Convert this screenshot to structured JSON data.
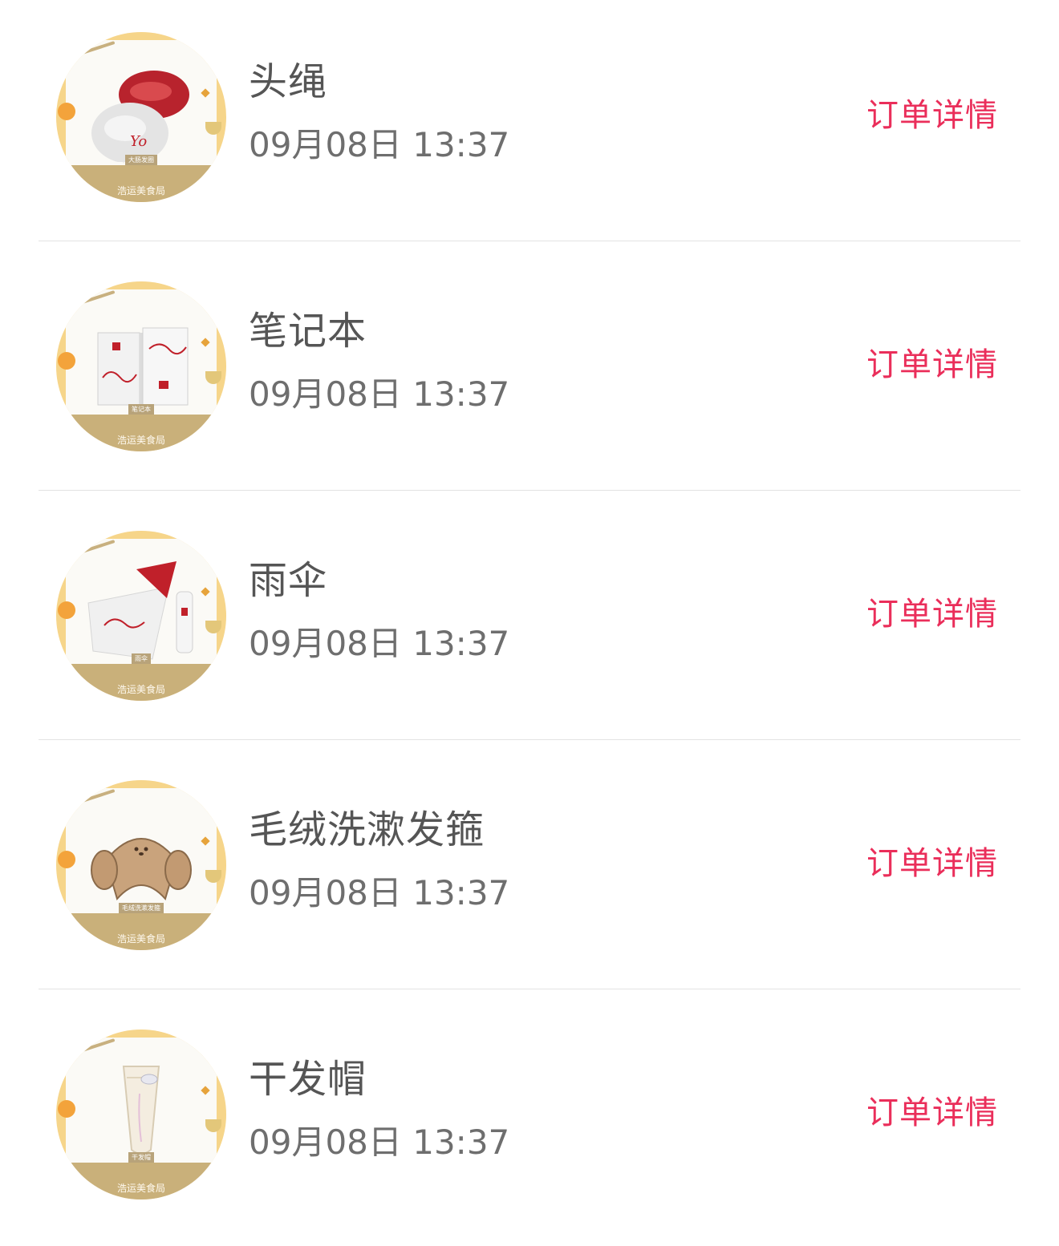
{
  "orders": [
    {
      "name": "头绳",
      "time": "09月08日 13:37",
      "detail_label": "订单详情",
      "thumb_brand": "浩运美食局",
      "thumb_tag": "大肠发圈"
    },
    {
      "name": "笔记本",
      "time": "09月08日 13:37",
      "detail_label": "订单详情",
      "thumb_brand": "浩运美食局",
      "thumb_tag": "笔记本"
    },
    {
      "name": "雨伞",
      "time": "09月08日 13:37",
      "detail_label": "订单详情",
      "thumb_brand": "浩运美食局",
      "thumb_tag": "雨伞"
    },
    {
      "name": "毛绒洗漱发箍",
      "time": "09月08日 13:37",
      "detail_label": "订单详情",
      "thumb_brand": "浩运美食局",
      "thumb_tag": "毛绒洗漱发箍"
    },
    {
      "name": "干发帽",
      "time": "09月08日 13:37",
      "detail_label": "订单详情",
      "thumb_brand": "浩运美食局",
      "thumb_tag": "干发帽"
    }
  ],
  "colors": {
    "accent": "#ea2e5a",
    "title": "#555555",
    "time": "#6e6e6e",
    "divider": "#e3e3e3",
    "thumb_ring": "#f6d58a",
    "thumb_band": "#c9b07a"
  }
}
